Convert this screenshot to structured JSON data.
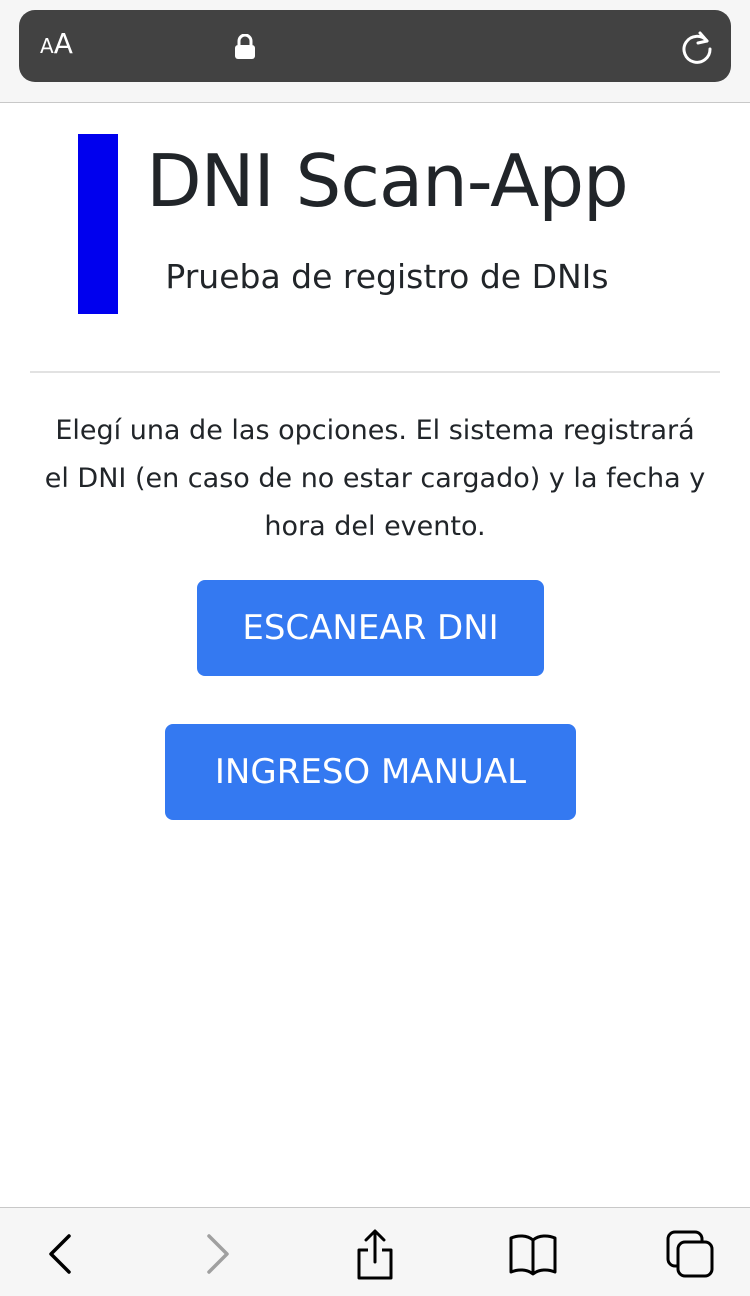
{
  "browser": {
    "text_size_label_small": "A",
    "text_size_label_big": "A",
    "chrome_bg": "#424242",
    "toolbar_bg": "#f6f6f6"
  },
  "icons": {
    "text_size": "text-size-icon",
    "lock": "lock-icon",
    "reload": "reload-icon",
    "back": "chevron-left-icon",
    "forward": "chevron-right-icon",
    "share": "share-icon",
    "bookmarks": "book-icon",
    "tabs": "tabs-icon"
  },
  "header": {
    "title": "DNI Scan-App",
    "subtitle": "Prueba de registro de DNIs",
    "accent_color": "#0000ee"
  },
  "main": {
    "instructions": "Elegí una de las opciones. El sistema registrará el DNI (en caso de no estar cargado) y la fecha y hora del evento.",
    "scan_button_label": "ESCANEAR DNI",
    "manual_button_label": "INGRESO MANUAL",
    "button_color": "#3479f1"
  }
}
